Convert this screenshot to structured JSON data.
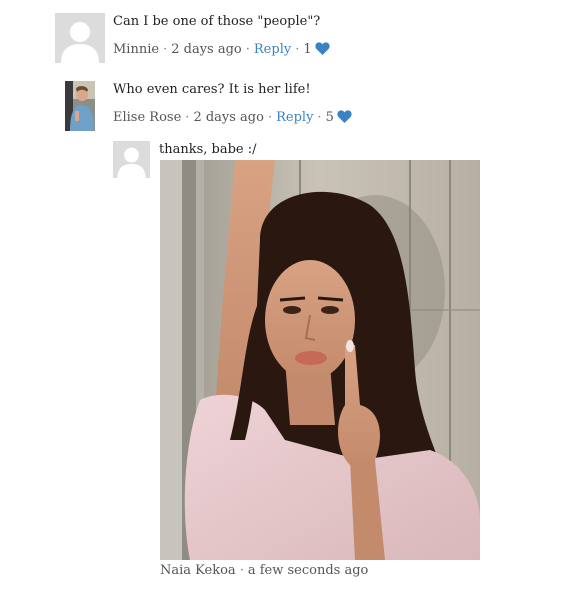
{
  "comments": [
    {
      "text": "Can I be one of those \"people\"?",
      "author": "Minnie",
      "time": "2 days ago",
      "reply_label": "Reply",
      "likes": "1",
      "sep": "·"
    },
    {
      "text": "Who even cares? It is her life!",
      "author": "Elise Rose",
      "time": "2 days ago",
      "reply_label": "Reply",
      "likes": "5",
      "sep": "·"
    },
    {
      "text": "thanks, babe :/",
      "author": "Naia Kekoa",
      "time": "a few seconds ago",
      "sep": "·"
    }
  ],
  "colors": {
    "link": "#3b82c4",
    "heart": "#3b82c4",
    "avatar_placeholder": "#dcdcdc"
  },
  "icons": {
    "heart": "heart-icon",
    "default_avatar": "user-silhouette-icon"
  }
}
